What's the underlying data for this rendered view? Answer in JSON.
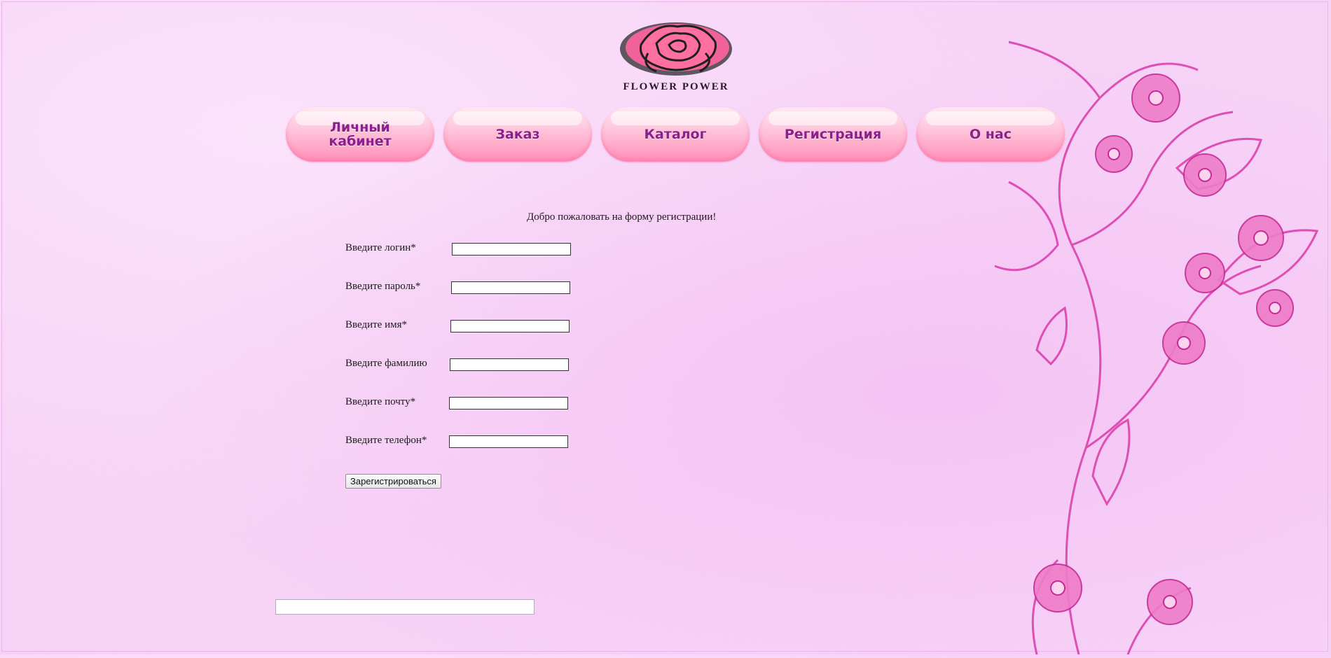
{
  "brand": {
    "logo_text": "FLOWER POWER"
  },
  "nav": {
    "items": [
      {
        "label": "Личный кабинет"
      },
      {
        "label": "Заказ"
      },
      {
        "label": "Каталог"
      },
      {
        "label": "Регистрация"
      },
      {
        "label": "О нас"
      }
    ]
  },
  "form": {
    "welcome": "Добро пожаловать на форму регистрации!",
    "fields": [
      {
        "label": "Введите логин*",
        "value": ""
      },
      {
        "label": "Введите  пароль*",
        "value": ""
      },
      {
        "label": "Введите имя*",
        "value": ""
      },
      {
        "label": "Введите фамилию",
        "value": ""
      },
      {
        "label": "Введите почту*",
        "value": ""
      },
      {
        "label": "Введите телефон*",
        "value": ""
      }
    ],
    "submit_label": "Зарегистрироваться"
  },
  "footer": {
    "value": ""
  },
  "colors": {
    "background": "#f7d2f7",
    "nav_text": "#8a1f8e",
    "nav_button": "#ff8fb7",
    "flower": "#e040b0"
  },
  "icons": {
    "logo": "rose-icon"
  }
}
